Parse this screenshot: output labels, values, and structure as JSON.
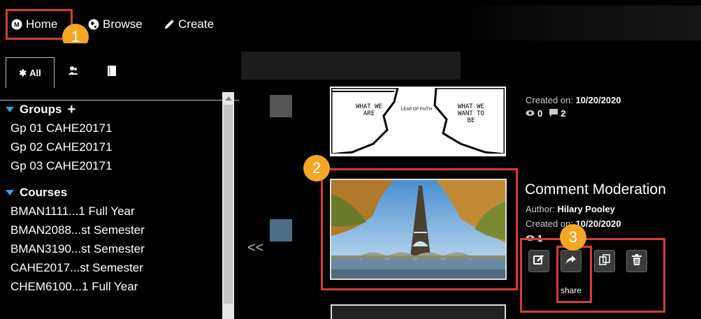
{
  "nav": {
    "home_label": "Home",
    "browse_label": "Browse",
    "create_label": "Create"
  },
  "tabs": [
    {
      "label": "All",
      "icon": "asterisk-icon"
    },
    {
      "label": "",
      "icon": "people-icon"
    },
    {
      "label": "",
      "icon": "book-icon"
    }
  ],
  "groups": {
    "heading": "Groups",
    "items": [
      "Gp 01 CAHE20171",
      "Gp 02 CAHE20171",
      "Gp 03 CAHE20171"
    ]
  },
  "courses": {
    "heading": "Courses",
    "items": [
      "BMAN1111...1 Full Year",
      "BMAN2088...st Semester",
      "BMAN3190...st Semester",
      "CAHE2017...st Semester",
      "CHEM6100...1 Full Year"
    ]
  },
  "main": {
    "collapse_label": "<<",
    "card1": {
      "created_label": "Created on:",
      "created_date": "10/20/2020",
      "views": "0",
      "comments": "2",
      "image_text_left": "WHAT WE ARE",
      "image_text_mid": "LEAP OF FAITH",
      "image_text_right": "WHAT WE WANT TO BE"
    },
    "card2": {
      "title": "Comment Moderation",
      "author_label": "Author:",
      "author": "Hilary Pooley",
      "created_label": "Created on:",
      "created_date": "10/20/2020",
      "views": "1"
    },
    "actions": {
      "edit_icon": "edit-icon",
      "share_icon": "share-icon",
      "copy_icon": "copy-icon",
      "delete_icon": "trash-icon",
      "tooltip": "share"
    }
  },
  "annotations": [
    "1",
    "2",
    "3"
  ],
  "colors": {
    "accent_red": "#d93a3a",
    "badge_orange": "#f5a623",
    "triangle_blue": "#3aa0e8",
    "square_gray": "#555555",
    "square_blue": "#4b6e85"
  }
}
